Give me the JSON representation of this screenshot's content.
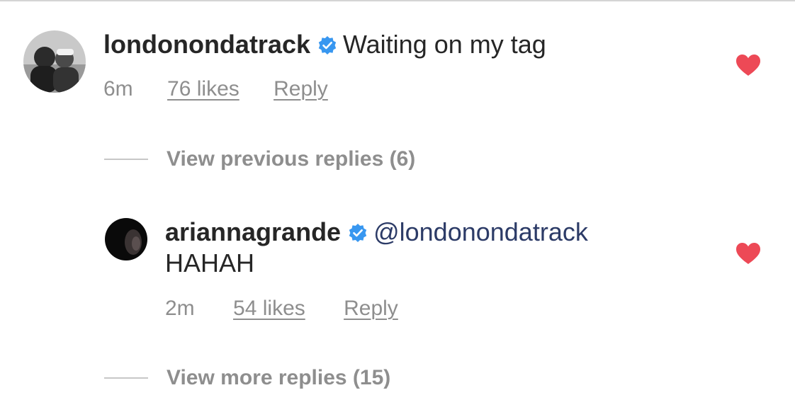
{
  "colors": {
    "username": "#262626",
    "text": "#262626",
    "meta": "#8e8e8e",
    "mention": "#2c3b67",
    "heart": "#ed4956",
    "verified": "#3897f0"
  },
  "comment": {
    "username": "londonondatrack",
    "verified_icon": "verified-badge-icon",
    "text": "Waiting on my tag",
    "time": "6m",
    "likes": "76 likes",
    "reply": "Reply",
    "liked": true,
    "heart_icon": "heart-filled-icon",
    "view_previous": "View previous replies (6)"
  },
  "reply": {
    "username": "ariannagrande",
    "verified_icon": "verified-badge-icon",
    "mention": "@londonondatrack",
    "text": "HAHAH",
    "time": "2m",
    "likes": "54 likes",
    "reply": "Reply",
    "liked": true,
    "heart_icon": "heart-filled-icon",
    "view_more": "View more replies (15)"
  }
}
